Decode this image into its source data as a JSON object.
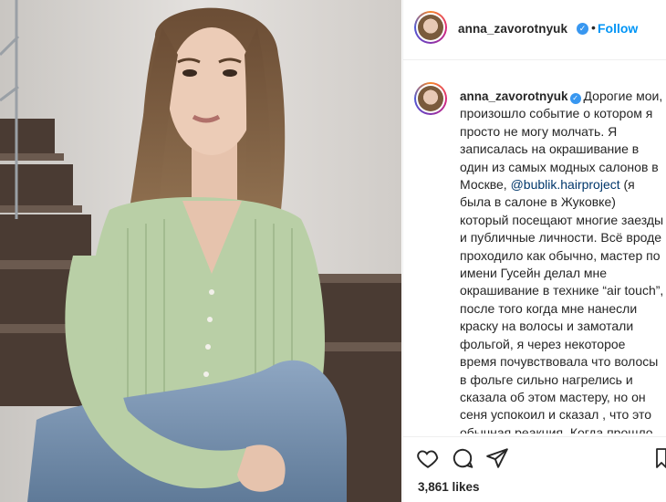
{
  "post": {
    "photo_alt": "photo",
    "header": {
      "username": "anna_zavorotnyuk",
      "follow_label": "Follow",
      "separator": "•"
    },
    "caption": {
      "username": "anna_zavorotnyuk",
      "text_part1": "Дорогие мои, произошло событие о котором я просто не могу молчать. Я записалась на окрашивание в один из самых модных салонов в Москве, ",
      "mention": "@bublik.hairproject",
      "text_part2": " (я была в салоне в Жуковке) который посещают многие заезды и публичные личности. Всё вроде проходило как обычно, мастер по имени Гусейн делал мне окрашивание в технике “air touch”, после того когда мне нанесли краску на волосы и замотали фольгой, я через некоторое время почувствовала что волосы в фольге сильно нагрелись и сказала об этом мастеру, но он сеня успокоил и сказал , что это обычная реакция. Когда прошло время мы пошли смывать меня в Мойке, а"
    },
    "likes": "3,861 likes"
  },
  "icons": {
    "like": "heart-icon",
    "comment": "comment-icon",
    "share": "share-icon",
    "save": "bookmark-icon",
    "verified": "verified-icon"
  },
  "colors": {
    "follow": "#0095f6",
    "verified": "#3897f0",
    "mention": "#00376b"
  }
}
